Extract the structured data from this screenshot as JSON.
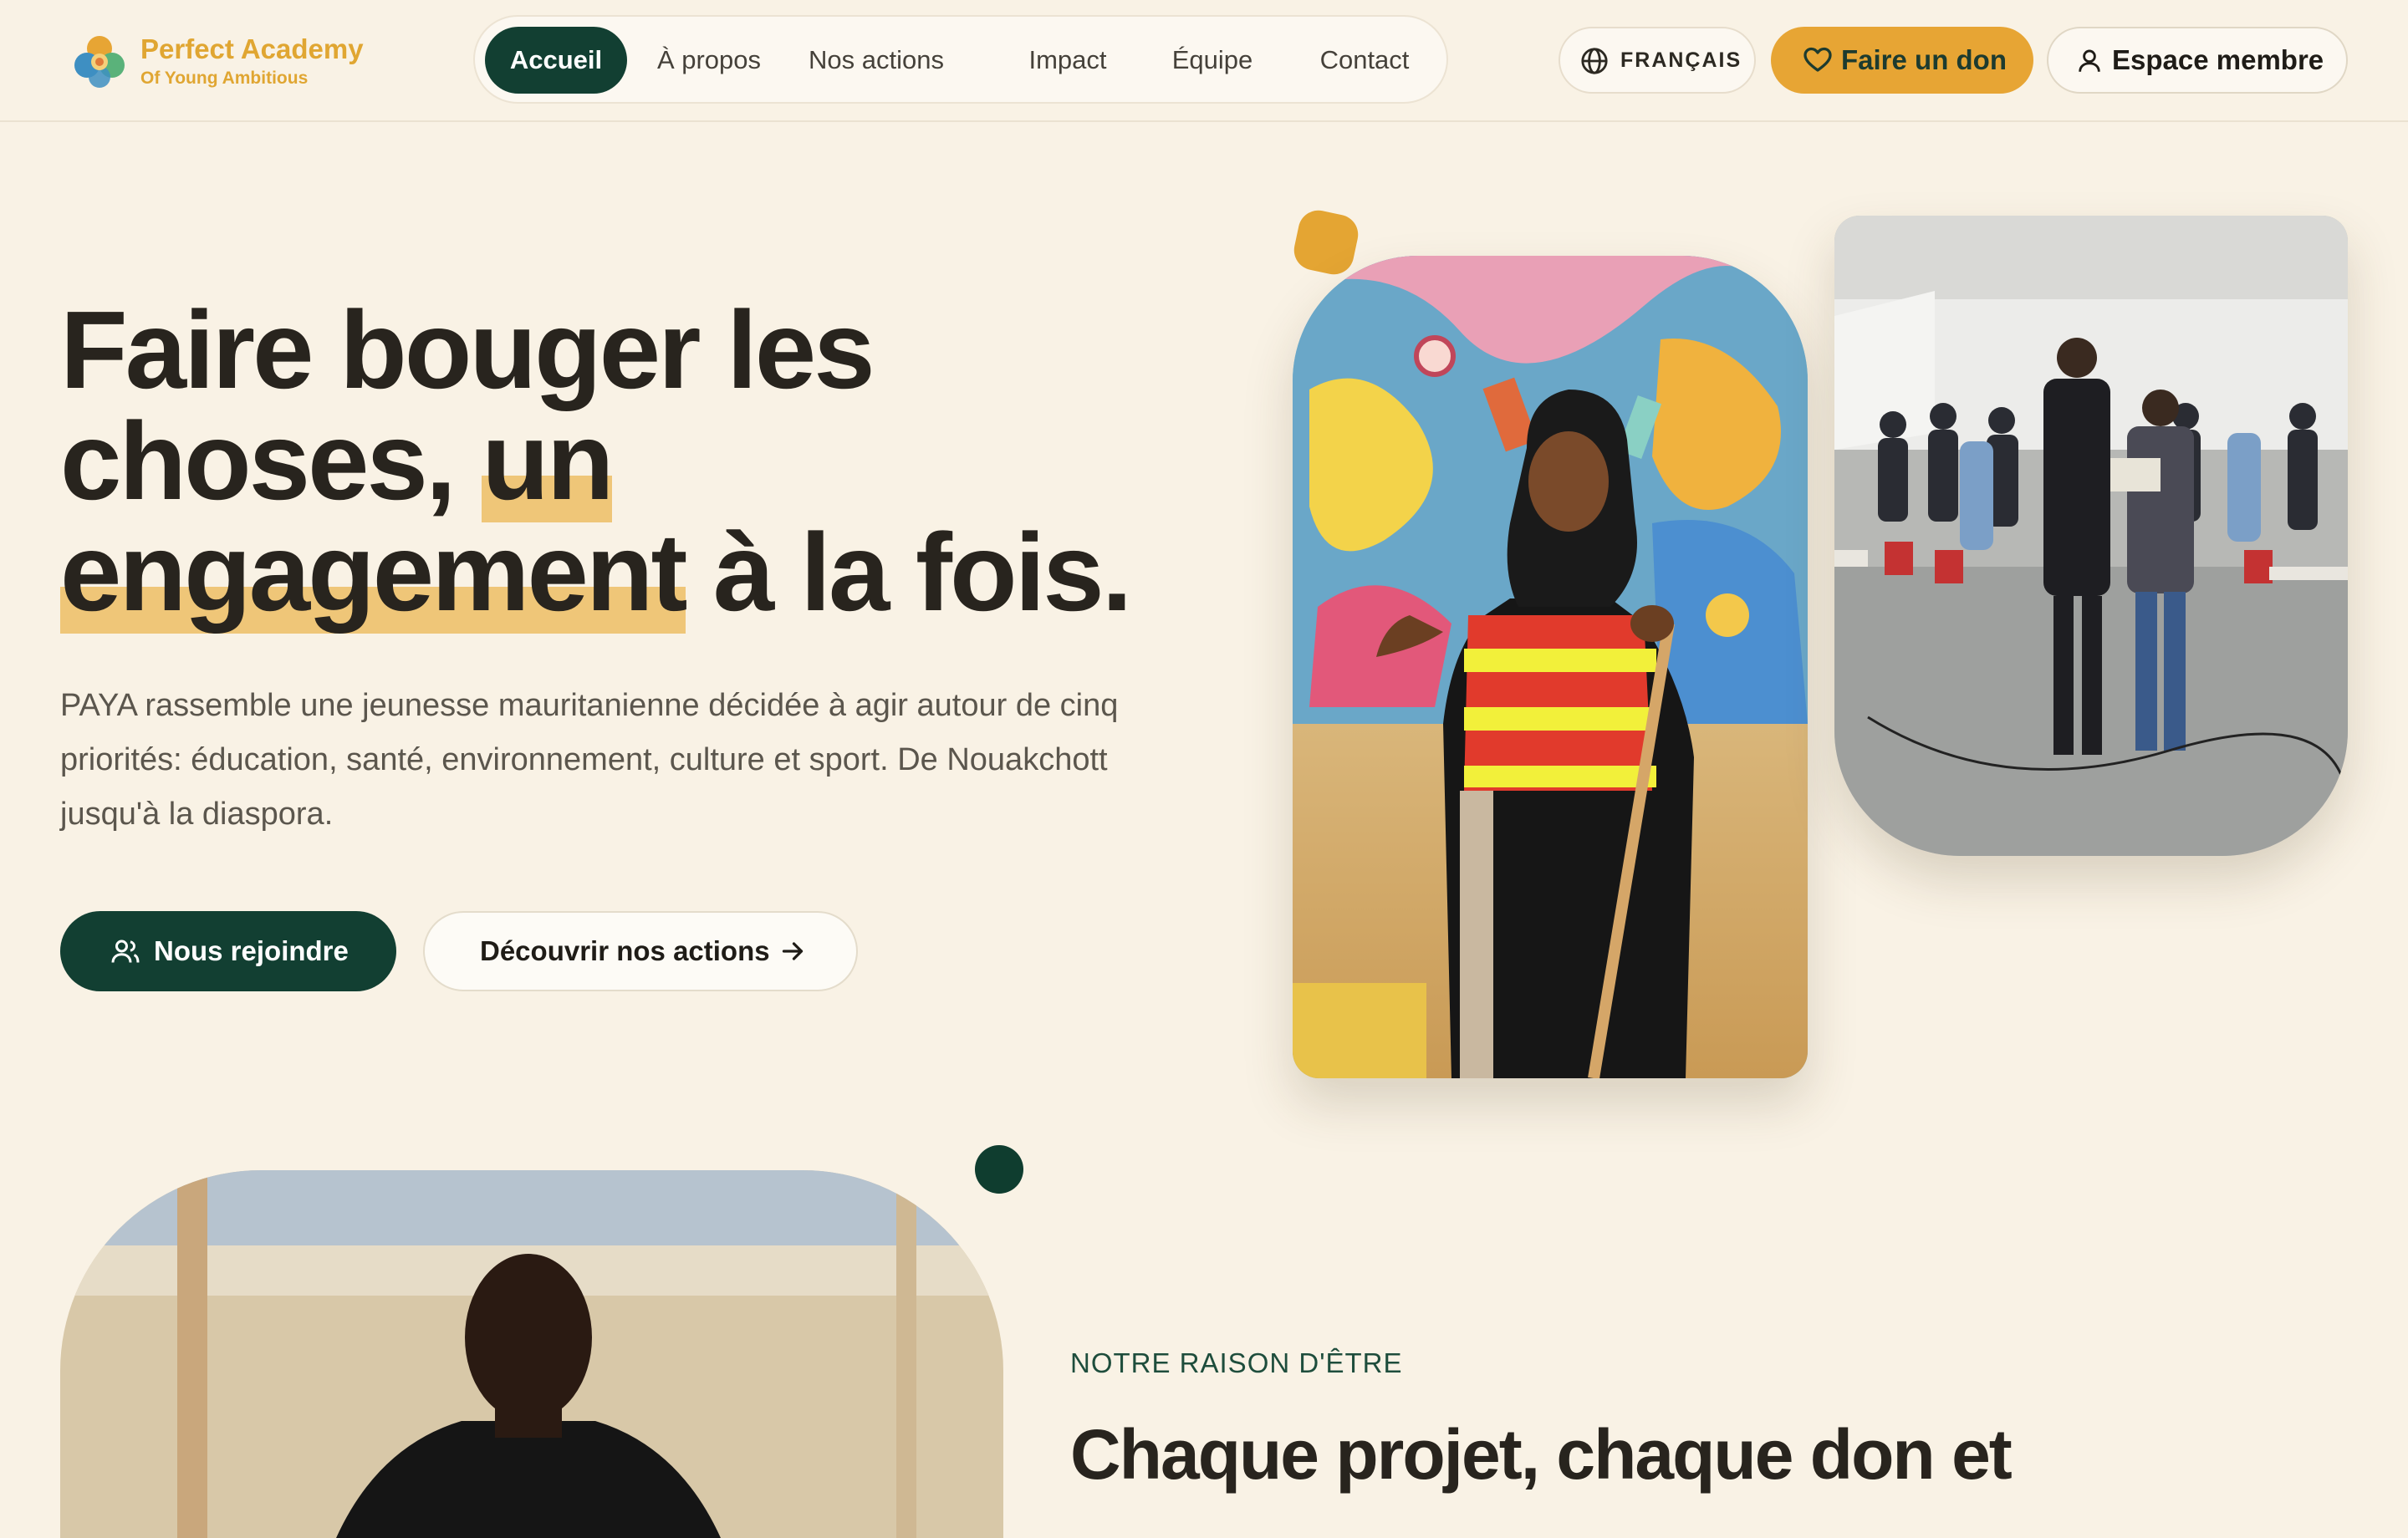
{
  "header": {
    "brand_name": "Perfect Academy",
    "brand_subtitle": "Of Young Ambitious",
    "nav": [
      {
        "label": "Accueil",
        "active": true
      },
      {
        "label": "À propos"
      },
      {
        "label": "Nos actions"
      },
      {
        "label": "Impact"
      },
      {
        "label": "Équipe"
      },
      {
        "label": "Contact"
      }
    ],
    "language_label": "FRANÇAIS",
    "donate_label": "Faire un don",
    "member_label": "Espace membre"
  },
  "hero": {
    "title_part1": "Faire bouger les choses, ",
    "title_highlight1": "un",
    "title_highlight2": "engagement",
    "title_part2": " à la fois.",
    "description": "PAYA rassemble une jeunesse mauritanienne décidée à agir autour de cinq priorités: éducation, santé, environnement, culture et sport. De Nouakchott jusqu'à la diaspora.",
    "primary_cta": "Nous rejoindre",
    "secondary_cta": "Découvrir nos actions"
  },
  "section": {
    "eyebrow": "NOTRE RAISON D'ÊTRE",
    "title": "Chaque projet, chaque don et"
  },
  "colors": {
    "background": "#f9f2e5",
    "brand_green": "#123f32",
    "accent_yellow": "#e7a534",
    "highlight": "#efc678"
  }
}
